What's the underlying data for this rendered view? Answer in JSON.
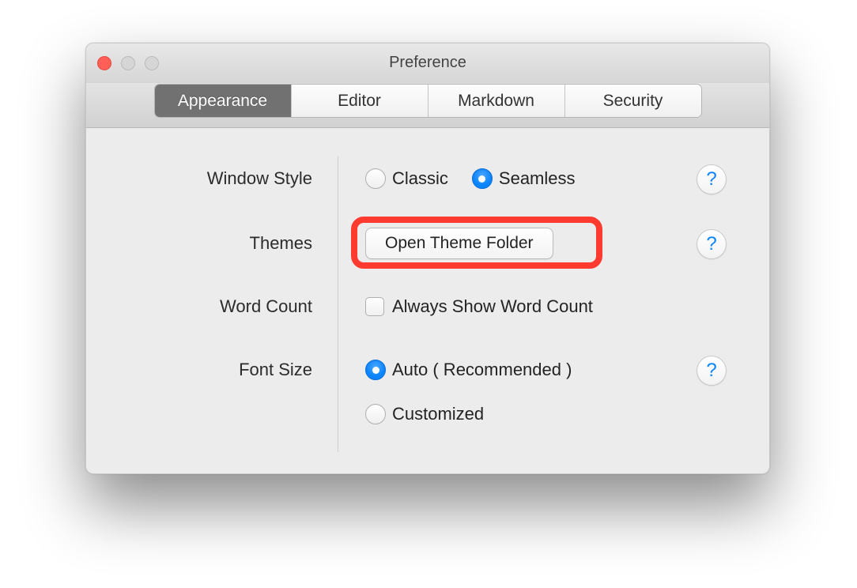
{
  "window": {
    "title": "Preference"
  },
  "tabs": [
    {
      "label": "Appearance",
      "active": true
    },
    {
      "label": "Editor",
      "active": false
    },
    {
      "label": "Markdown",
      "active": false
    },
    {
      "label": "Security",
      "active": false
    }
  ],
  "labels": {
    "window_style": "Window Style",
    "themes": "Themes",
    "word_count": "Word Count",
    "font_size": "Font Size"
  },
  "window_style": {
    "option_classic": "Classic",
    "option_seamless": "Seamless",
    "selected": "Seamless"
  },
  "themes": {
    "button_label": "Open Theme Folder",
    "highlighted": true
  },
  "word_count": {
    "checkbox_label": "Always Show Word Count",
    "checked": false
  },
  "font_size": {
    "option_auto": "Auto ( Recommended )",
    "option_customized": "Customized",
    "selected": "Auto ( Recommended )"
  },
  "help_glyph": "?"
}
